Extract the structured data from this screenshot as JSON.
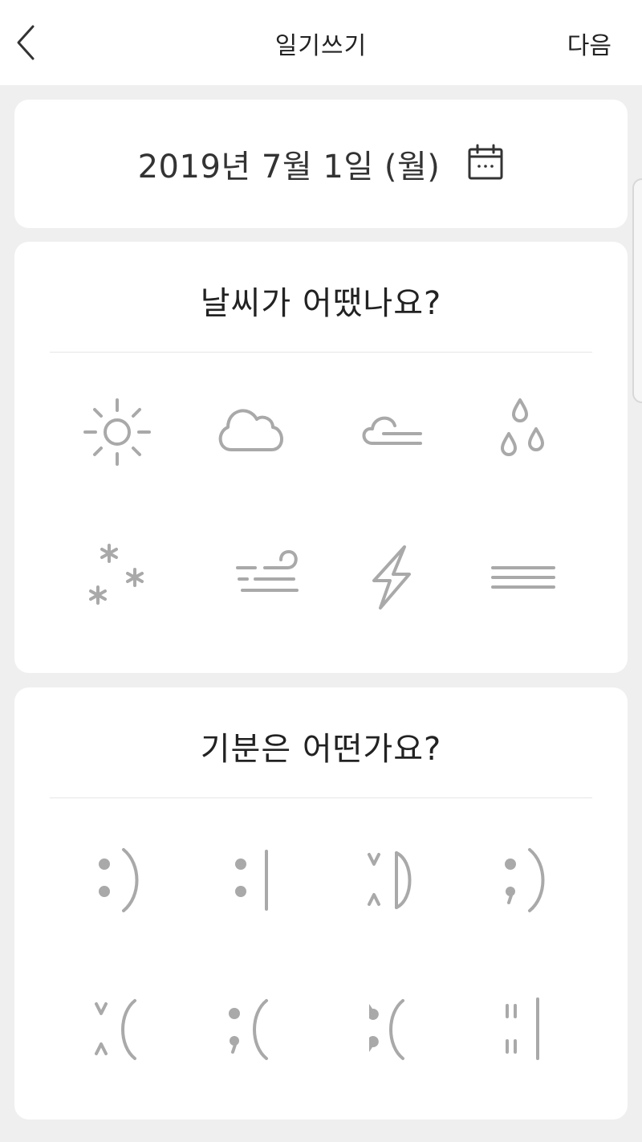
{
  "header": {
    "title": "일기쓰기",
    "next_label": "다음",
    "back_icon": "chevron-left-icon"
  },
  "date": {
    "text": "2019년 7월 1일 (월)",
    "icon": "calendar-icon"
  },
  "weather": {
    "title": "날씨가 어땠나요?",
    "options": [
      "sun-icon",
      "cloud-icon",
      "wind-cloud-icon",
      "rain-icon",
      "snow-icon",
      "windy-icon",
      "lightning-icon",
      "fog-icon"
    ]
  },
  "mood": {
    "title": "기분은 어떤가요?",
    "options": [
      ":)",
      ":|",
      "XD",
      ";)",
      "X(",
      ";(",
      "T(",
      "||"
    ]
  },
  "colors": {
    "background": "#efefef",
    "card": "#ffffff",
    "icon": "#a9a9a9",
    "text": "#222222"
  }
}
